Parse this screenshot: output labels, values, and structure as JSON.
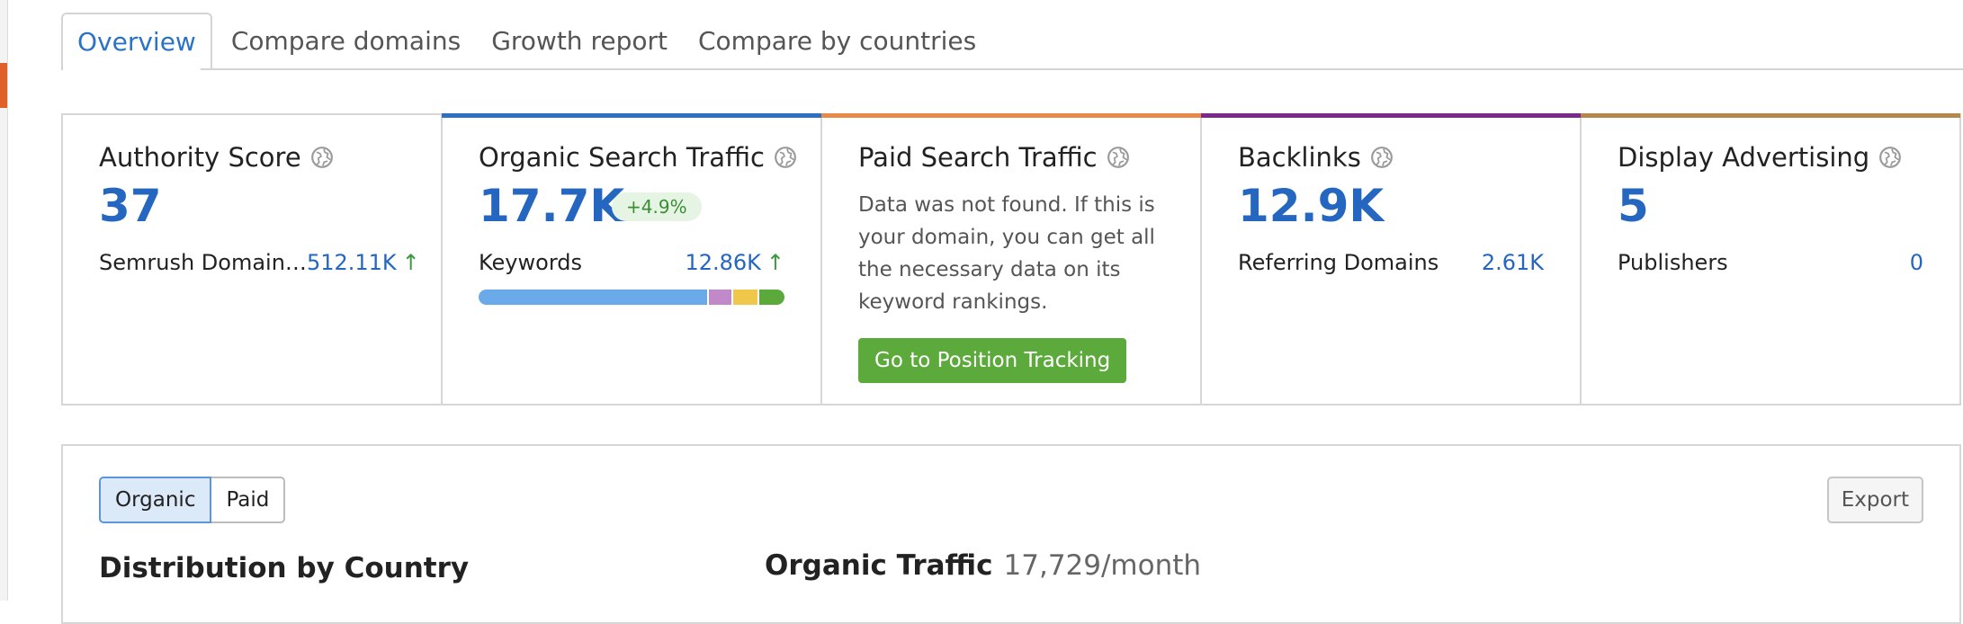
{
  "tabs": [
    {
      "label": "Overview",
      "active": true
    },
    {
      "label": "Compare domains"
    },
    {
      "label": "Growth report"
    },
    {
      "label": "Compare by countries"
    }
  ],
  "colors": {
    "accent_blue": "#2466c0",
    "organic_bar": "#2e6fc2",
    "paid_bar": "#e8894a",
    "backlinks_bar": "#7b2a8c",
    "display_bar": "#b5874b",
    "cta_green": "#5daa3c"
  },
  "cards": {
    "authority": {
      "title": "Authority Score",
      "value": "37",
      "row_label": "Semrush Domain…",
      "row_value": "512.11K",
      "row_arrow": "↑",
      "icon": "globe-icon"
    },
    "organic": {
      "title": "Organic Search Traffic",
      "value": "17.7K",
      "badge": "+4.9%",
      "row_label": "Keywords",
      "row_value": "12.86K",
      "row_arrow": "↑",
      "icon": "globe-icon",
      "keyword_distribution": [
        {
          "color": "#6aaae8",
          "share": 0.76
        },
        {
          "color": "#c189c9",
          "share": 0.075
        },
        {
          "color": "#efc74b",
          "share": 0.08
        },
        {
          "color": "#5aa93a",
          "share": 0.085
        }
      ]
    },
    "paid": {
      "title": "Paid Search Traffic",
      "message": "Data was not found. If this is your domain, you can get all the necessary data on its keyword rankings.",
      "cta": "Go to Position Tracking",
      "icon": "globe-icon"
    },
    "backlinks": {
      "title": "Backlinks",
      "value": "12.9K",
      "row_label": "Referring Domains",
      "row_value": "2.61K",
      "icon": "globe-icon"
    },
    "display": {
      "title": "Display Advertising",
      "value": "5",
      "row_label": "Publishers",
      "row_value": "0",
      "icon": "globe-icon"
    }
  },
  "distribution": {
    "toggle": [
      "Organic",
      "Paid"
    ],
    "selected": "Organic",
    "export_label": "Export",
    "title": "Distribution by Country",
    "traffic_label": "Organic Traffic",
    "traffic_value": "17,729/month"
  }
}
